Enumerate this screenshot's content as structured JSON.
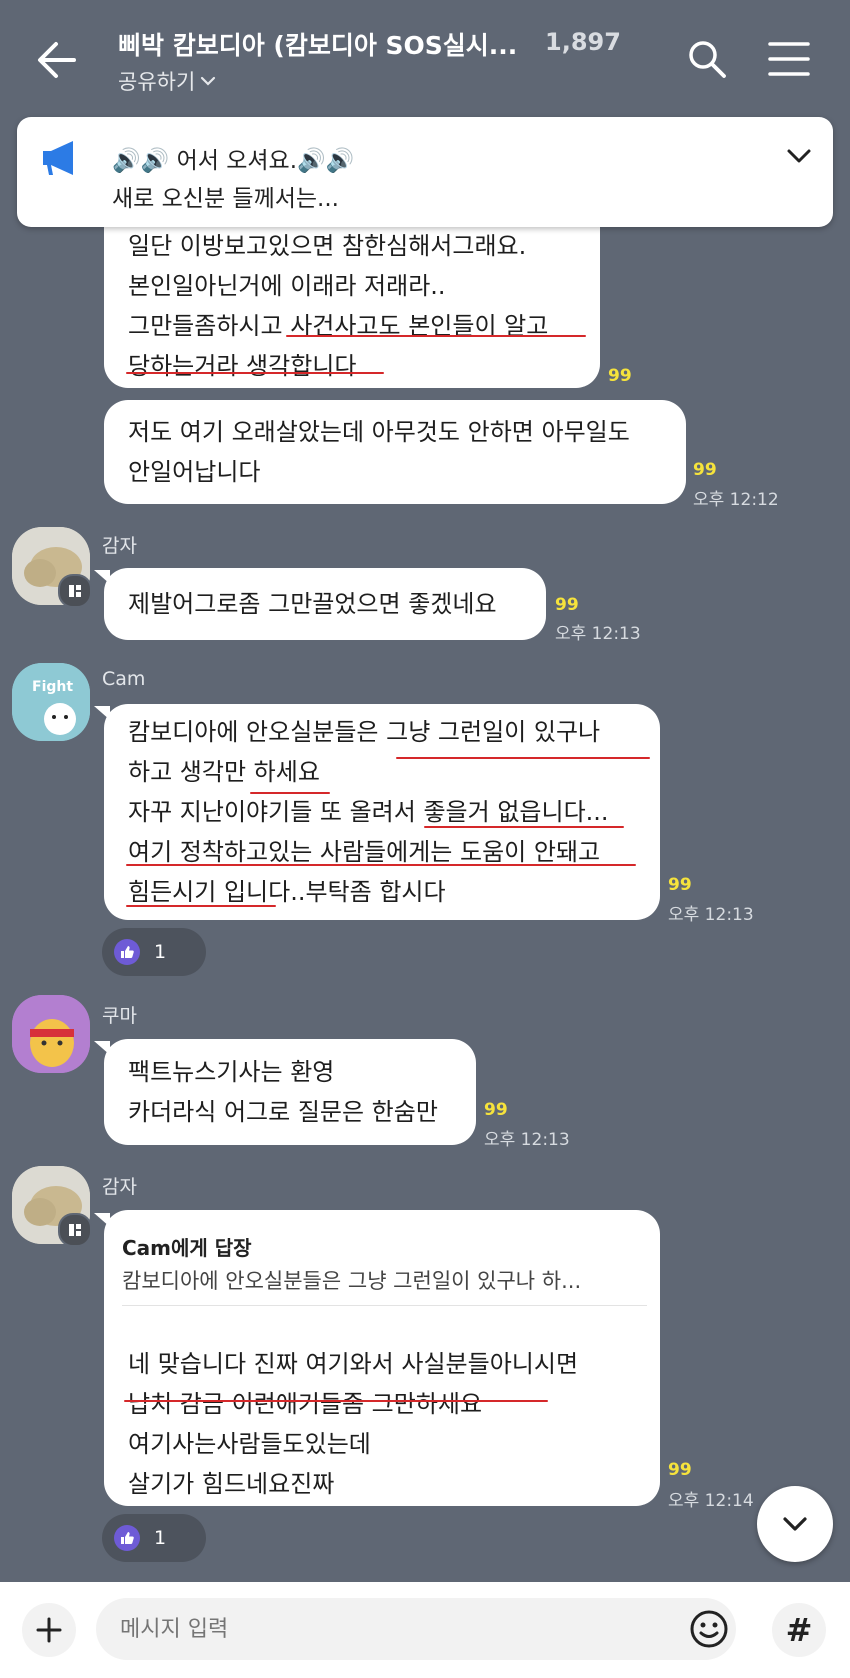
{
  "header": {
    "title": "삐박 캄보디아  (캄보디아  SOS실시...",
    "member_count": "1,897",
    "share_label": "공유하기"
  },
  "notice": {
    "line1": "🔊🔊 어서 오셔요.🔊🔊",
    "line2": "새로 오신분 들께서는..."
  },
  "messages": [
    {
      "lines": [
        "일단 이방보고있으면 참한심해서그래요.",
        "본인일아닌거에 이래라 저래라..",
        "그만들좀하시고 사건사고도 본인들이 알고",
        "당하는거라 생각합니다"
      ],
      "read": "99",
      "time": ""
    },
    {
      "lines": [
        "저도 여기 오래살았는데 아무것도 안하면 아무일도",
        "안일어납니다"
      ],
      "read": "99",
      "time": "오후 12:12"
    },
    {
      "sender": "감자",
      "lines": [
        "제발어그로좀 그만끌었으면 좋겠네요"
      ],
      "read": "99",
      "time": "오후 12:13"
    },
    {
      "sender": "Cam",
      "avatar_text": "Fight",
      "lines": [
        "캄보디아에 안오실분들은 그냥 그런일이 있구나",
        "하고 생각만 하세요",
        "자꾸 지난이야기들 또 올려서 좋을거 없읍니다...",
        "여기 정착하고있는 사람들에게는 도움이 안돼고",
        "힘든시기 입니다..부탁좀 합시다"
      ],
      "read": "99",
      "time": "오후 12:13",
      "reaction_count": "1"
    },
    {
      "sender": "쿠마",
      "lines": [
        "팩트뉴스기사는 환영",
        "카더라식 어그로 질문은 한숨만"
      ],
      "read": "99",
      "time": "오후 12:13"
    },
    {
      "sender": "감자",
      "reply_to": "Cam에게 답장",
      "reply_quote": "캄보디아에 안오실분들은 그냥 그런일이 있구나 하...",
      "lines": [
        "네 맞습니다 진짜 여기와서 사실분들아니시면",
        "납치 감금 이런애기들좀 그만하세요",
        "여기사는사람들도있는데",
        "살기가 힘드네요진짜"
      ],
      "read": "99",
      "time": "오후 12:14",
      "reaction_count": "1"
    }
  ],
  "input": {
    "placeholder": "메시지 입력",
    "hash_label": "#"
  },
  "colors": {
    "background": "#5f6774",
    "bubble": "#ffffff",
    "read_count": "#f6e33c",
    "underline": "#d5282a"
  }
}
